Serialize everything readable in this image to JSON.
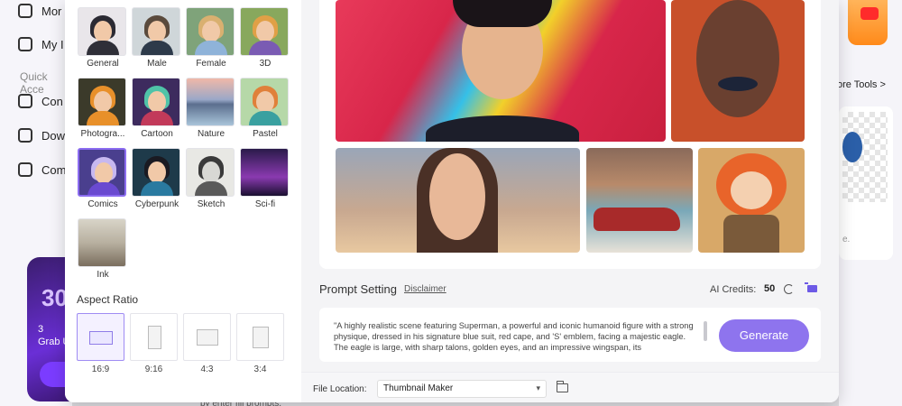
{
  "background": {
    "sidebar_items": [
      {
        "label": "Mor",
        "icon": "mail-icon"
      },
      {
        "label": "My I",
        "icon": "folder-icon"
      },
      {
        "label": "Con",
        "icon": "convert-icon"
      },
      {
        "label": "Dow",
        "icon": "download-icon"
      },
      {
        "label": "Com",
        "icon": "compress-icon"
      }
    ],
    "quick_access": "Quick Acce",
    "promo": {
      "big": "30",
      "line2": "3",
      "line3": "Grab U"
    },
    "more_tools": "ore Tools >",
    "card_text": "e.",
    "hint": "by enter fill prompts."
  },
  "styles": [
    {
      "label": "General"
    },
    {
      "label": "Male"
    },
    {
      "label": "Female"
    },
    {
      "label": "3D"
    },
    {
      "label": "Photogra..."
    },
    {
      "label": "Cartoon"
    },
    {
      "label": "Nature"
    },
    {
      "label": "Pastel"
    },
    {
      "label": "Comics",
      "selected": true
    },
    {
      "label": "Cyberpunk"
    },
    {
      "label": "Sketch"
    },
    {
      "label": "Sci-fi"
    },
    {
      "label": "Ink"
    }
  ],
  "aspect": {
    "title": "Aspect Ratio",
    "options": [
      {
        "label": "16:9",
        "selected": true
      },
      {
        "label": "9:16"
      },
      {
        "label": "4:3"
      },
      {
        "label": "3:4"
      }
    ]
  },
  "prompt": {
    "title": "Prompt Setting",
    "disclaimer": "Disclaimer",
    "credits_label": "AI Credits:",
    "credits_value": "50",
    "text": "\"A highly realistic scene featuring Superman, a powerful and iconic humanoid figure with a strong physique, dressed in his signature blue suit, red cape, and 'S' emblem, facing a majestic eagle. The eagle is large, with sharp talons, golden eyes, and an impressive wingspan, its",
    "generate": "Generate"
  },
  "file_location": {
    "label": "File Location:",
    "value": "Thumbnail Maker"
  },
  "colors": {
    "accent": "#8e74ee",
    "selected_border": "#8b6cf0"
  }
}
